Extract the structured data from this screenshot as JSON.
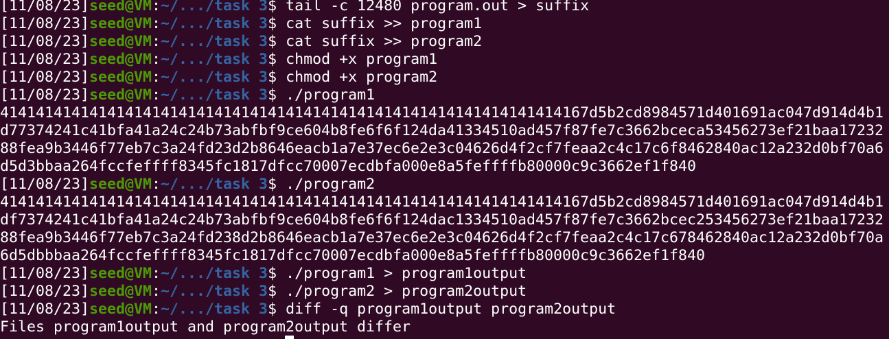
{
  "terminal": {
    "prompt": {
      "timestamp": "[11/08/23]",
      "user_host": "seed@VM",
      "colon": ":",
      "path": "~/.../task 3",
      "dollar": "$ "
    },
    "lines": [
      {
        "type": "cmd",
        "text": "tail -c 12480 program.out > suffix"
      },
      {
        "type": "cmd",
        "text": "cat suffix >> program1"
      },
      {
        "type": "cmd",
        "text": "cat suffix >> program2"
      },
      {
        "type": "cmd",
        "text": "chmod +x program1"
      },
      {
        "type": "cmd",
        "text": "chmod +x program2"
      },
      {
        "type": "cmd",
        "text": "./program1"
      },
      {
        "type": "out",
        "text": "414141414141414141414141414141414141414141414141414141414141414167d5b2cd8984571d401691ac047d914d4b1"
      },
      {
        "type": "out",
        "text": "d77374241c41bfa41a24c24b73abfbf9ce604b8fe6f6f124da41334510ad457f87fe7c3662bceca53456273ef21baa17232"
      },
      {
        "type": "out",
        "text": "88fea9b3446f77eb7c3a24fd23d2b8646eacb1a7e37ec6e2e3c04626d4f2cf7feaa2c4c17c6f8462840ac12a232d0bf70a6"
      },
      {
        "type": "out",
        "text": "d5d3bbaa264fccfeffff8345fc1817dfcc70007ecdbfa000e8a5feffffb80000c9c3662ef1f840"
      },
      {
        "type": "cmd",
        "text": "./program2"
      },
      {
        "type": "out",
        "text": "414141414141414141414141414141414141414141414141414141414141414167d5b2cd8984571d401691ac047d914d4b1"
      },
      {
        "type": "out",
        "text": "df7374241c41bfa41a24c24b73abfbf9ce604b8fe6f6f124dac1334510ad457f87fe7c3662bcec253456273ef21baa17232"
      },
      {
        "type": "out",
        "text": "88fea9b3446f77eb7c3a24fd238d2b8646eacb1a7e37ec6e2e3c04626d4f2cf7feaa2c4c17c678462840ac12a232d0bf70a"
      },
      {
        "type": "out",
        "text": "6d5dbbbaa264fccfeffff8345fc1817dfcc70007ecdbfa000e8a5feffffb80000c9c3662ef1f840"
      },
      {
        "type": "cmd",
        "text": "./program1 > program1output"
      },
      {
        "type": "cmd",
        "text": "./program2 > program2output"
      },
      {
        "type": "cmd",
        "text": "diff -q program1output program2output"
      },
      {
        "type": "out",
        "text": "Files program1output and program2output differ"
      }
    ],
    "colors": {
      "background": "#300a24",
      "user_host": "#4e9a06",
      "path": "#3465a4",
      "text": "#ffffff"
    }
  }
}
